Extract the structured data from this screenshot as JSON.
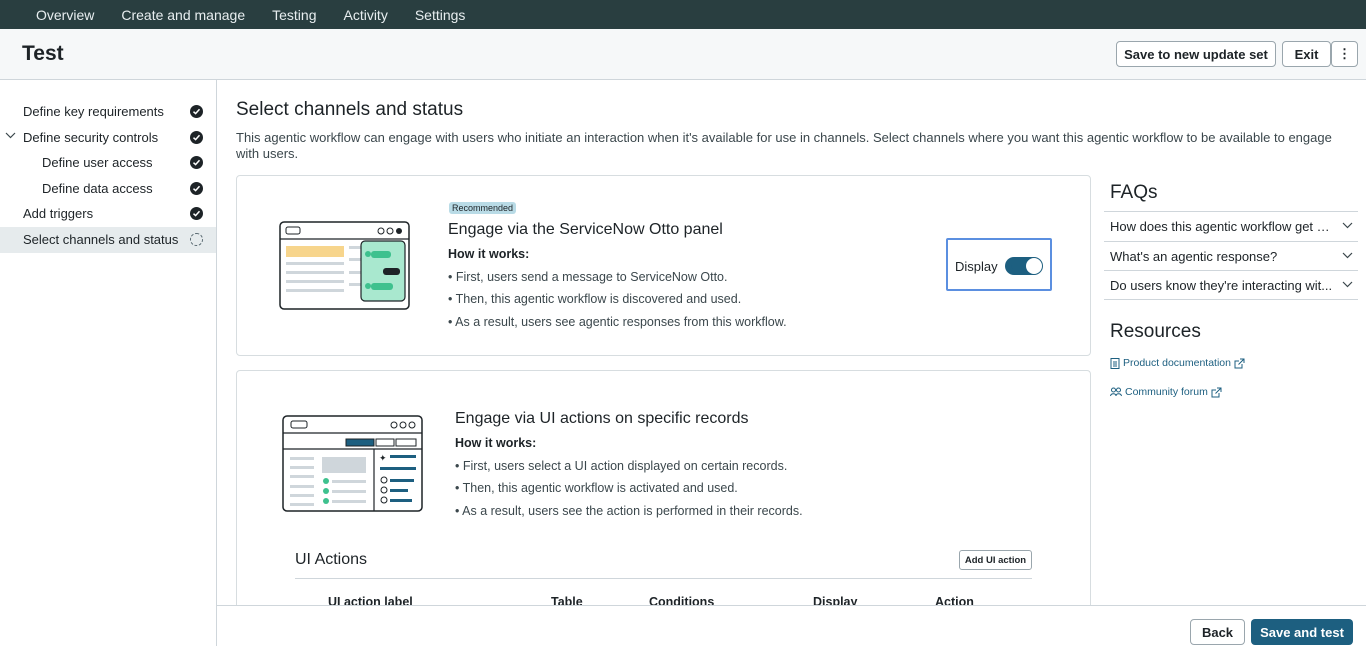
{
  "topnav": {
    "items": [
      "Overview",
      "Create and manage",
      "Testing",
      "Activity",
      "Settings"
    ]
  },
  "header": {
    "title": "Test",
    "save_update_label": "Save to new update set",
    "exit_label": "Exit",
    "more_label": "⋮"
  },
  "sidebar": {
    "steps": [
      {
        "label": "Define key requirements",
        "status": "complete"
      },
      {
        "label": "Define security controls",
        "status": "complete"
      },
      {
        "label": "Define user access",
        "status": "complete"
      },
      {
        "label": "Define data access",
        "status": "complete"
      },
      {
        "label": "Add triggers",
        "status": "complete"
      },
      {
        "label": "Select channels and status",
        "status": "in-progress"
      }
    ]
  },
  "main": {
    "title": "Select channels and status",
    "description": "This agentic workflow can engage with users who initiate an interaction when it's available for use in channels. Select channels where you want this agentic workflow to be available to engage with users.",
    "card1": {
      "badge": "Recommended",
      "title": "Engage via the ServiceNow Otto panel",
      "how": "How it works:",
      "bullets": [
        "• First, users send a message to ServiceNow Otto.",
        "• Then, this agentic workflow is discovered and used.",
        "• As a result, users see agentic responses from this workflow."
      ],
      "display_label": "Display",
      "display_on": true
    },
    "card2": {
      "title": "Engage via UI actions on specific records",
      "how": "How it works:",
      "bullets": [
        "• First, users select a UI action displayed on certain records.",
        "• Then, this agentic workflow is activated and used.",
        "• As a result, users see the action is performed in their records."
      ],
      "ui_actions_title": "UI Actions",
      "add_ui_action_label": "Add UI action",
      "columns": [
        "UI action label",
        "Table",
        "Conditions",
        "Display",
        "Action"
      ]
    }
  },
  "faq": {
    "title": "FAQs",
    "items": [
      "How does this agentic workflow get d...",
      "What's an agentic response?",
      "Do users know they're interacting wit..."
    ]
  },
  "resources": {
    "title": "Resources",
    "links": [
      "Product documentation",
      "Community forum"
    ]
  },
  "footer": {
    "back_label": "Back",
    "save_test_label": "Save and test"
  },
  "colors": {
    "nav_bg": "#293e40",
    "accent": "#1d5f80",
    "focus_outline": "#5b8fe0",
    "badge_bg": "#b9dbe6"
  }
}
